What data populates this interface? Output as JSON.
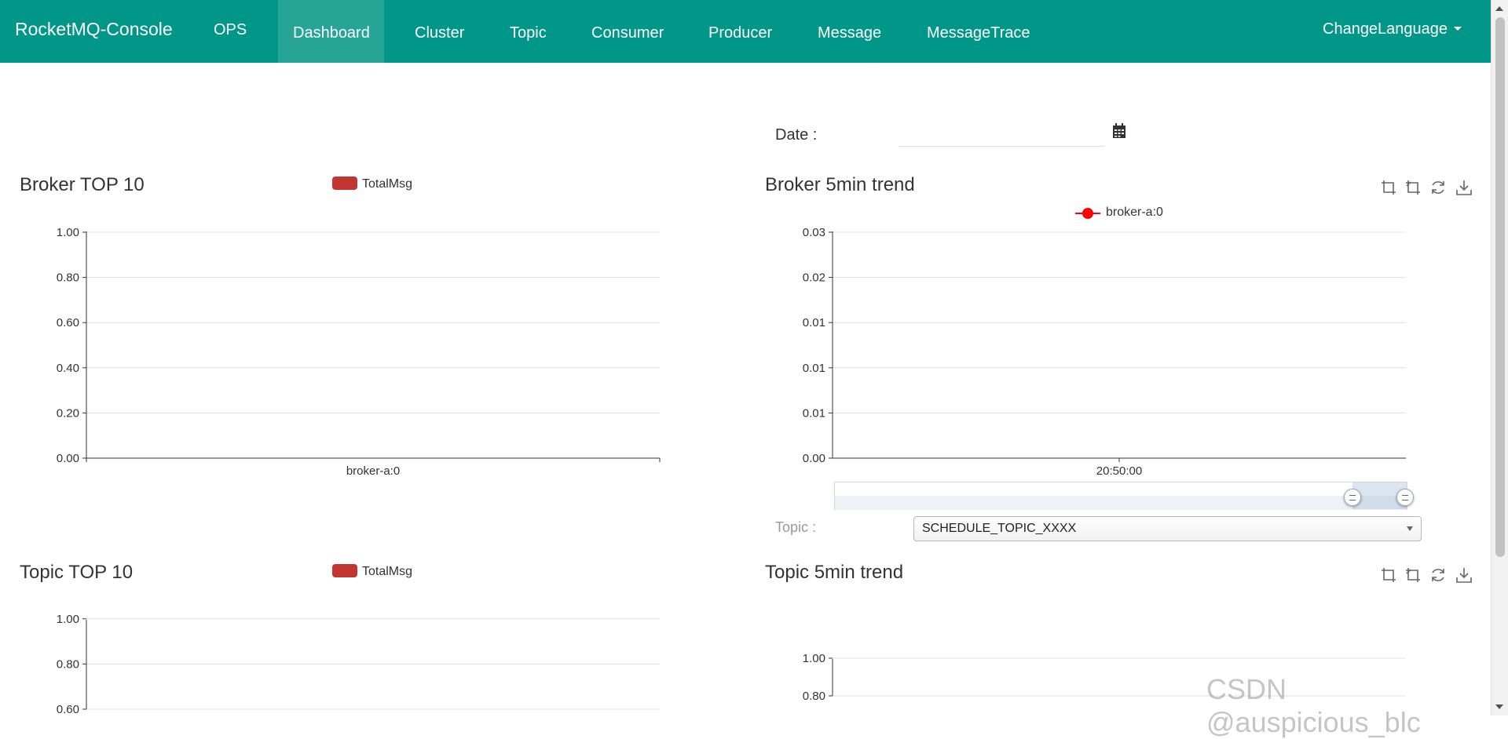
{
  "nav": {
    "brand": "RocketMQ-Console",
    "items": [
      {
        "label": "OPS"
      },
      {
        "label": "Dashboard",
        "active": true
      },
      {
        "label": "Cluster"
      },
      {
        "label": "Topic"
      },
      {
        "label": "Consumer"
      },
      {
        "label": "Producer"
      },
      {
        "label": "Message"
      },
      {
        "label": "MessageTrace"
      }
    ],
    "change_language": "ChangeLanguage",
    "color": "#009688",
    "active_color": "#26a597"
  },
  "date": {
    "label": "Date :",
    "value": "",
    "icon": "calendar-icon"
  },
  "topic_filter": {
    "label": "Topic :",
    "selected": "SCHEDULE_TOPIC_XXXX"
  },
  "toolbox_icons": [
    "data-zoom-icon",
    "zoom-reset-icon",
    "restore-icon",
    "save-image-icon"
  ],
  "watermark": "CSDN @auspicious_blc",
  "series_color": "#c23531",
  "trend_color": "#ff0000",
  "chart_data": [
    {
      "type": "bar",
      "title": "Broker TOP 10",
      "legend": [
        "TotalMsg"
      ],
      "categories": [
        "broker-a:0"
      ],
      "series": [
        {
          "name": "TotalMsg",
          "values": [
            0
          ]
        }
      ],
      "yticks": [
        "0.00",
        "0.20",
        "0.40",
        "0.60",
        "0.80",
        "1.00"
      ],
      "ylim": [
        0,
        1
      ],
      "grid": true
    },
    {
      "type": "line",
      "title": "Broker 5min trend",
      "legend": [
        "broker-a:0"
      ],
      "x": [
        "20:50:00"
      ],
      "series": [
        {
          "name": "broker-a:0",
          "values": []
        }
      ],
      "yticks": [
        "0.00",
        "0.01",
        "0.01",
        "0.01",
        "0.02",
        "0.03"
      ],
      "ylim": [
        0,
        0.03
      ],
      "grid": true,
      "zoom_range": [
        0.905,
        1.0
      ]
    },
    {
      "type": "bar",
      "title": "Topic TOP 10",
      "legend": [
        "TotalMsg"
      ],
      "categories": [],
      "series": [
        {
          "name": "TotalMsg",
          "values": []
        }
      ],
      "yticks": [
        "0.60",
        "0.80",
        "1.00"
      ],
      "ylim": [
        0,
        1
      ],
      "grid": true
    },
    {
      "type": "line",
      "title": "Topic 5min trend",
      "legend": [],
      "x": [],
      "series": [],
      "yticks": [
        "0.80",
        "1.00"
      ],
      "ylim": [
        0,
        1
      ],
      "grid": true
    }
  ]
}
